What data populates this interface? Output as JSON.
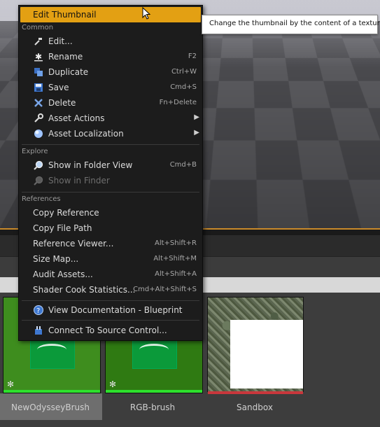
{
  "menu": {
    "highlight_item": "Edit Thumbnail",
    "sections": {
      "common": "Common",
      "explore": "Explore",
      "references": "References"
    },
    "common_items": [
      {
        "label": "Edit...",
        "shortcut": "",
        "icon": "hammer-icon"
      },
      {
        "label": "Rename",
        "shortcut": "F2",
        "icon": "rename-icon"
      },
      {
        "label": "Duplicate",
        "shortcut": "Ctrl+W",
        "icon": "duplicate-icon"
      },
      {
        "label": "Save",
        "shortcut": "Cmd+S",
        "icon": "save-icon"
      },
      {
        "label": "Delete",
        "shortcut": "Fn+Delete",
        "icon": "delete-icon"
      },
      {
        "label": "Asset Actions",
        "shortcut": "",
        "icon": "wrench-icon"
      },
      {
        "label": "Asset Localization",
        "shortcut": "",
        "icon": "globe-icon"
      }
    ],
    "explore_items": [
      {
        "label": "Show in Folder View",
        "shortcut": "Cmd+B",
        "icon": "magnifier-icon"
      },
      {
        "label": "Show in Finder",
        "shortcut": "",
        "icon": "magnifier-icon"
      }
    ],
    "reference_items": [
      {
        "label": "Copy Reference",
        "shortcut": ""
      },
      {
        "label": "Copy File Path",
        "shortcut": ""
      },
      {
        "label": "Reference Viewer...",
        "shortcut": "Alt+Shift+R"
      },
      {
        "label": "Size Map...",
        "shortcut": "Alt+Shift+M"
      },
      {
        "label": "Audit Assets...",
        "shortcut": "Alt+Shift+A"
      },
      {
        "label": "Shader Cook Statistics...",
        "shortcut": "Cmd+Alt+Shift+S"
      }
    ],
    "doc_item": "View Documentation - Blueprint",
    "source_control_item": "Connect To Source Control..."
  },
  "tooltip": "Change the thumbnail by the content of a texture",
  "assets": [
    {
      "name": "NewOdysseyBrush",
      "selected": true
    },
    {
      "name": "RGB-brush",
      "selected": false
    },
    {
      "name": "Sandbox",
      "selected": false
    }
  ],
  "colors": {
    "highlight": "#e3a013",
    "asset_bar_green": "#2de02d",
    "asset_bar_red": "#c8373c"
  }
}
